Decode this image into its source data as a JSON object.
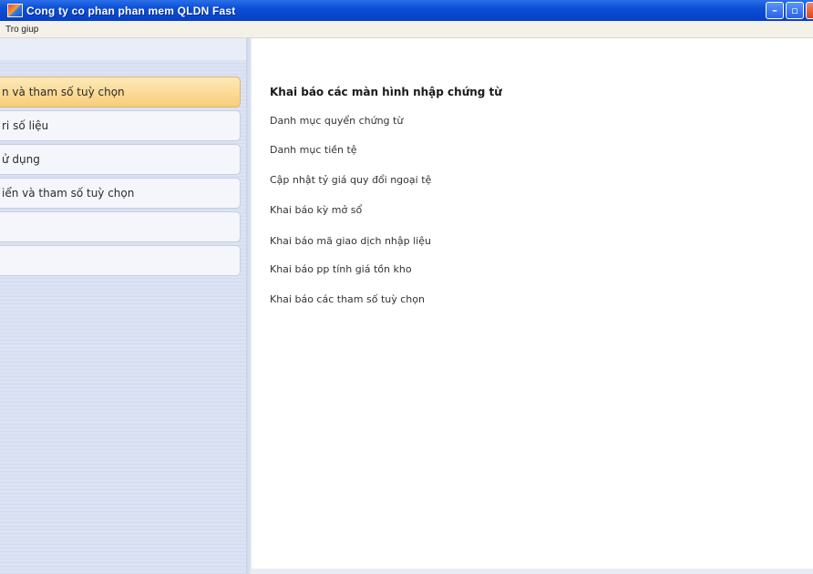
{
  "window": {
    "title": "Cong ty co phan phan mem QLDN Fast",
    "buttons": {
      "minimize": "–",
      "maximize": "▫",
      "close": ""
    }
  },
  "menu": {
    "items": [
      "Tro giup"
    ]
  },
  "sidebar": {
    "items": [
      {
        "label": "n và tham số tuỳ chọn",
        "active": true
      },
      {
        "label": "ri số liệu",
        "active": false
      },
      {
        "label": "ử dụng",
        "active": false
      },
      {
        "label": "iển và tham số tuỳ chọn",
        "active": false
      },
      {
        "label": "",
        "active": false
      },
      {
        "label": "",
        "active": false
      }
    ]
  },
  "main": {
    "title": "Khai báo các màn hình nhập chứng từ",
    "links": [
      "Danh mục quyển chứng từ",
      "Danh mục tiền tệ",
      "Cập nhật tỷ giá quy đổi ngoại tệ",
      "Khai báo kỳ mở sổ",
      "Khai báo mã giao dịch nhập liệu",
      "Khai báo pp tính giá tồn kho",
      "Khai báo các tham số tuỳ chọn"
    ]
  }
}
